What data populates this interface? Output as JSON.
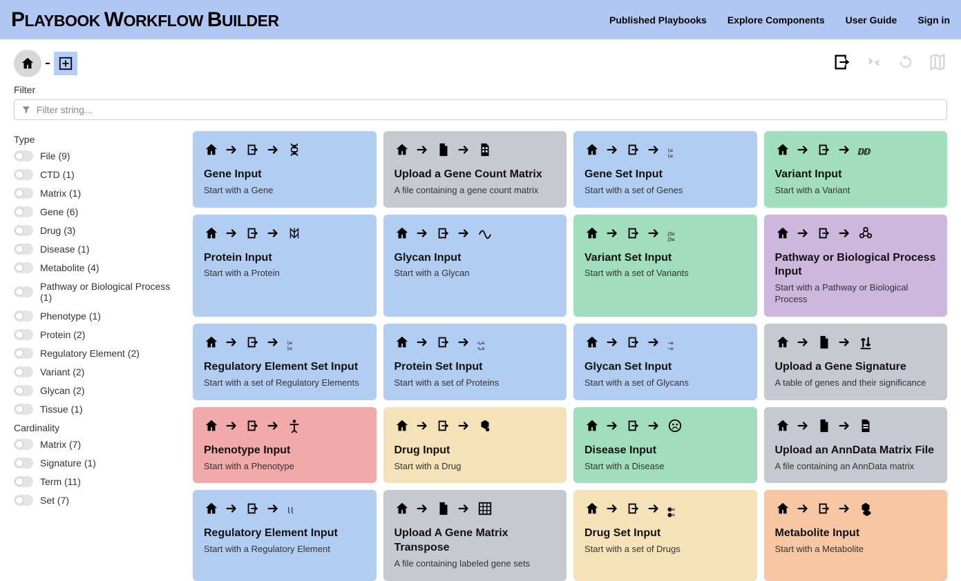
{
  "header": {
    "nav": [
      "Published Playbooks",
      "Explore Components",
      "User Guide",
      "Sign in"
    ]
  },
  "filter": {
    "label": "Filter",
    "placeholder": "Filter string..."
  },
  "sidebar": {
    "type_heading": "Type",
    "type_filters": [
      "File (9)",
      "CTD (1)",
      "Matrix (1)",
      "Gene (6)",
      "Drug (3)",
      "Disease (1)",
      "Metabolite (4)",
      "Pathway or Biological Process (1)",
      "Phenotype (1)",
      "Protein (2)",
      "Regulatory Element (2)",
      "Variant (2)",
      "Glycan (2)",
      "Tissue (1)"
    ],
    "card_heading": "Cardinality",
    "card_filters": [
      "Matrix (7)",
      "Signature (1)",
      "Term (11)",
      "Set (7)"
    ]
  },
  "cards": [
    {
      "title": "Gene Input",
      "desc": "Start with a Gene",
      "color": "c-blue",
      "seq": "h>in>dna"
    },
    {
      "title": "Upload a Gene Count Matrix",
      "desc": "A file containing a gene count matrix",
      "color": "c-gray",
      "seq": "h>file>table"
    },
    {
      "title": "Gene Set Input",
      "desc": "Start with a set of Genes",
      "color": "c-blue",
      "seq": "h>in>dnalist"
    },
    {
      "title": "Variant Input",
      "desc": "Start with a Variant",
      "color": "c-green",
      "seq": "h>in>variant"
    },
    {
      "title": "Protein Input",
      "desc": "Start with a Protein",
      "color": "c-blue",
      "seq": "h>in>protein"
    },
    {
      "title": "Glycan Input",
      "desc": "Start with a Glycan",
      "color": "c-blue",
      "seq": "h>in>glycan"
    },
    {
      "title": "Variant Set Input",
      "desc": "Start with a set of Variants",
      "color": "c-green",
      "seq": "h>in>variantlist"
    },
    {
      "title": "Pathway or Biological Process Input",
      "desc": "Start with a Pathway or Biological Process",
      "color": "c-purple",
      "seq": "h>in>pathway"
    },
    {
      "title": "Regulatory Element Set Input",
      "desc": "Start with a set of Regulatory Elements",
      "color": "c-blue",
      "seq": "h>in>reglist"
    },
    {
      "title": "Protein Set Input",
      "desc": "Start with a set of Proteins",
      "color": "c-blue",
      "seq": "h>in>proteinlist"
    },
    {
      "title": "Glycan Set Input",
      "desc": "Start with a set of Glycans",
      "color": "c-blue",
      "seq": "h>in>glycanlist"
    },
    {
      "title": "Upload a Gene Signature",
      "desc": "A table of genes and their significance",
      "color": "c-gray",
      "seq": "h>file>updown"
    },
    {
      "title": "Phenotype Input",
      "desc": "Start with a Phenotype",
      "color": "c-red",
      "seq": "h>in>person"
    },
    {
      "title": "Drug Input",
      "desc": "Start with a Drug",
      "color": "c-yellow",
      "seq": "h>in>drug"
    },
    {
      "title": "Disease Input",
      "desc": "Start with a Disease",
      "color": "c-green",
      "seq": "h>in>disease"
    },
    {
      "title": "Upload an AnnData Matrix File",
      "desc": "A file containing an AnnData matrix",
      "color": "c-gray",
      "seq": "h>file>file2"
    },
    {
      "title": "Regulatory Element Input",
      "desc": "Start with a Regulatory Element",
      "color": "c-blue",
      "seq": "h>in>reg"
    },
    {
      "title": "Upload A Gene Matrix Transpose",
      "desc": "A file containing labeled gene sets",
      "color": "c-gray",
      "seq": "h>file>matrix"
    },
    {
      "title": "Drug Set Input",
      "desc": "Start with a set of Drugs",
      "color": "c-yellow",
      "seq": "h>in>druglist"
    },
    {
      "title": "Metabolite Input",
      "desc": "Start with a Metabolite",
      "color": "c-orange",
      "seq": "h>in>metabolite"
    }
  ]
}
